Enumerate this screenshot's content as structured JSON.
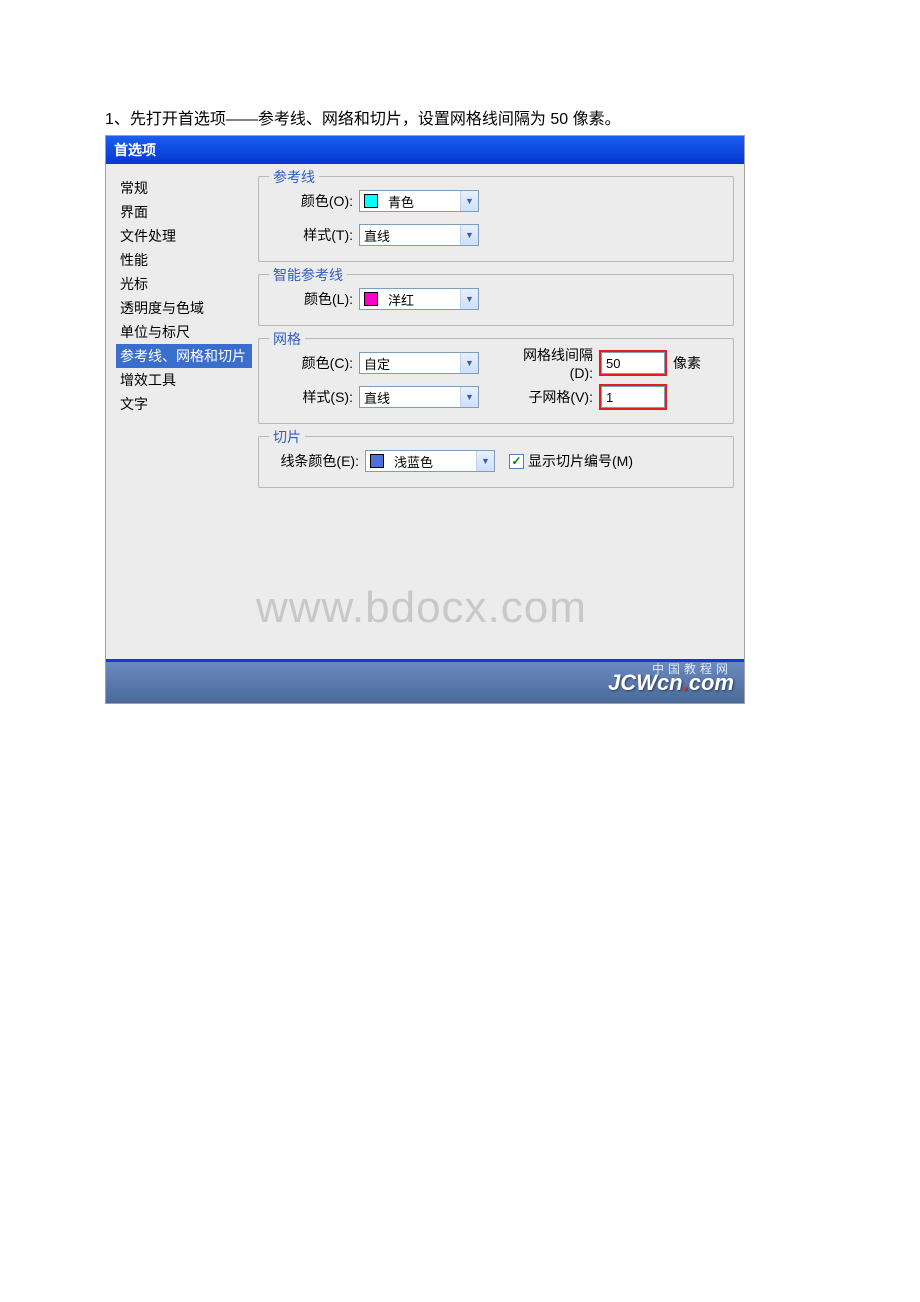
{
  "instruction": "1、先打开首选项——参考线、网络和切片，设置网格线间隔为 50 像素。",
  "dialog": {
    "title": "首选项"
  },
  "sidebar": {
    "items": [
      "常规",
      "界面",
      "文件处理",
      "性能",
      "光标",
      "透明度与色域",
      "单位与标尺",
      "参考线、网格和切片",
      "增效工具",
      "文字"
    ],
    "selected_index": 7
  },
  "guides": {
    "legend": "参考线",
    "color_label": "颜色(O):",
    "color_value": "青色",
    "color_swatch": "#00ffff",
    "style_label": "样式(T):",
    "style_value": "直线"
  },
  "smart_guides": {
    "legend": "智能参考线",
    "color_label": "颜色(L):",
    "color_value": "洋红",
    "color_swatch": "#ff00cc"
  },
  "grid": {
    "legend": "网格",
    "color_label": "颜色(C):",
    "color_value": "自定",
    "style_label": "样式(S):",
    "style_value": "直线",
    "interval_label": "网格线间隔(D):",
    "interval_value": "50",
    "interval_unit": "像素",
    "subgrid_label": "子网格(V):",
    "subgrid_value": "1"
  },
  "slice": {
    "legend": "切片",
    "color_label": "线条颜色(E):",
    "color_value": "浅蓝色",
    "color_swatch": "#5070d8",
    "checkbox_label": "显示切片编号(M)",
    "checkbox_checked": true
  },
  "watermark": "www.bdocx.com",
  "footer": {
    "subtext": "中国教程网",
    "logo_prefix": "JCWcn",
    "logo_dot": ".",
    "logo_suffix": "com"
  }
}
